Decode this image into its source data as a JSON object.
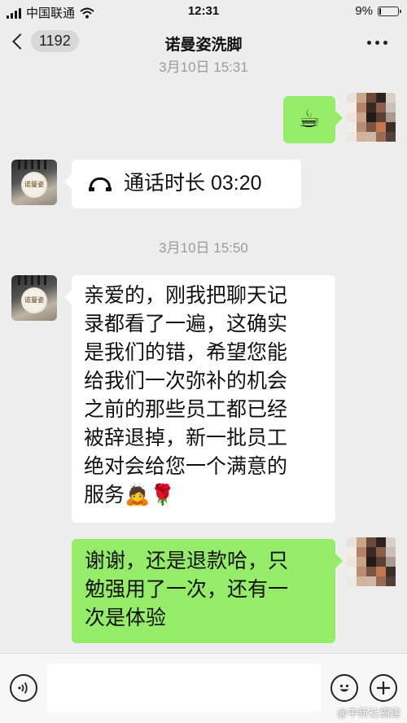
{
  "status_bar": {
    "carrier": "中国联通",
    "time": "12:31",
    "battery_text": "9%",
    "battery_level": 0.09
  },
  "nav": {
    "unread_count": "1192",
    "title": "诺曼姿洗脚",
    "back_icon": "chevron-left-icon",
    "more_icon": "more-dots-icon"
  },
  "messages": {
    "ts1": "3月10日 15:31",
    "cup_emoji": "☕",
    "call_duration": "通话时长 03:20",
    "ts2": "3月10日 15:50",
    "shop_avatar_text": "诺曼姿",
    "apology_lines": [
      "亲爱的，刚我把聊天记",
      "录都看了一遍，这确实",
      "是我们的错，希望您能",
      "给我们一次弥补的机会",
      "之前的那些员工都已经",
      "被辞退掉，新一批员工",
      "绝对会给您一个满意的",
      "服务🙇🌹"
    ],
    "reply_lines": [
      "谢谢，还是退款哈，只",
      "勉强用了一次，还有一",
      "次是体验"
    ]
  },
  "input_bar": {
    "voice_icon": "voice-icon",
    "emoji_icon": "emoji-icon",
    "plus_icon": "plus-icon",
    "placeholder": ""
  },
  "watermark": "@中新社福建",
  "colors": {
    "background": "#ededed",
    "left_bubble": "#ffffff",
    "right_bubble": "#95ec69",
    "timestamp": "#9b9b9b"
  }
}
